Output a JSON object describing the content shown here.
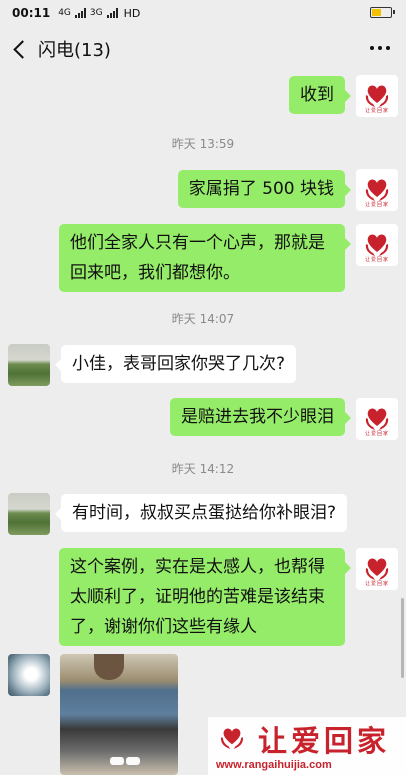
{
  "status": {
    "time": "00:11",
    "net1": "4G",
    "net2": "3G",
    "hd": "HD"
  },
  "header": {
    "title": "闪电(13)"
  },
  "timestamps": [
    "昨天 13:59",
    "昨天 14:07",
    "昨天 14:12"
  ],
  "messages": [
    {
      "side": "out",
      "text": "收到"
    },
    {
      "side": "out",
      "text": "家属捐了 500 块钱"
    },
    {
      "side": "out",
      "text": "他们全家人只有一个心声，那就是回来吧，我们都想你。"
    },
    {
      "side": "in",
      "text": "小佳，表哥回家你哭了几次?"
    },
    {
      "side": "out",
      "text": "是赔进去我不少眼泪"
    },
    {
      "side": "in",
      "text": "有时间，叔叔买点蛋挞给你补眼泪?"
    },
    {
      "side": "out",
      "text": "这个案例，实在是太感人，也帮得太顺利了，证明他的苦难是该结束了，谢谢你们这些有缘人"
    }
  ],
  "brand": {
    "avatar_text": "让爱回家",
    "title": "让爱回家",
    "url": "www.rangaihuijia.com"
  },
  "colors": {
    "outgoing_bubble": "#95ec69",
    "incoming_bubble": "#ffffff",
    "background": "#ededed",
    "brand_red": "#c8232c"
  }
}
